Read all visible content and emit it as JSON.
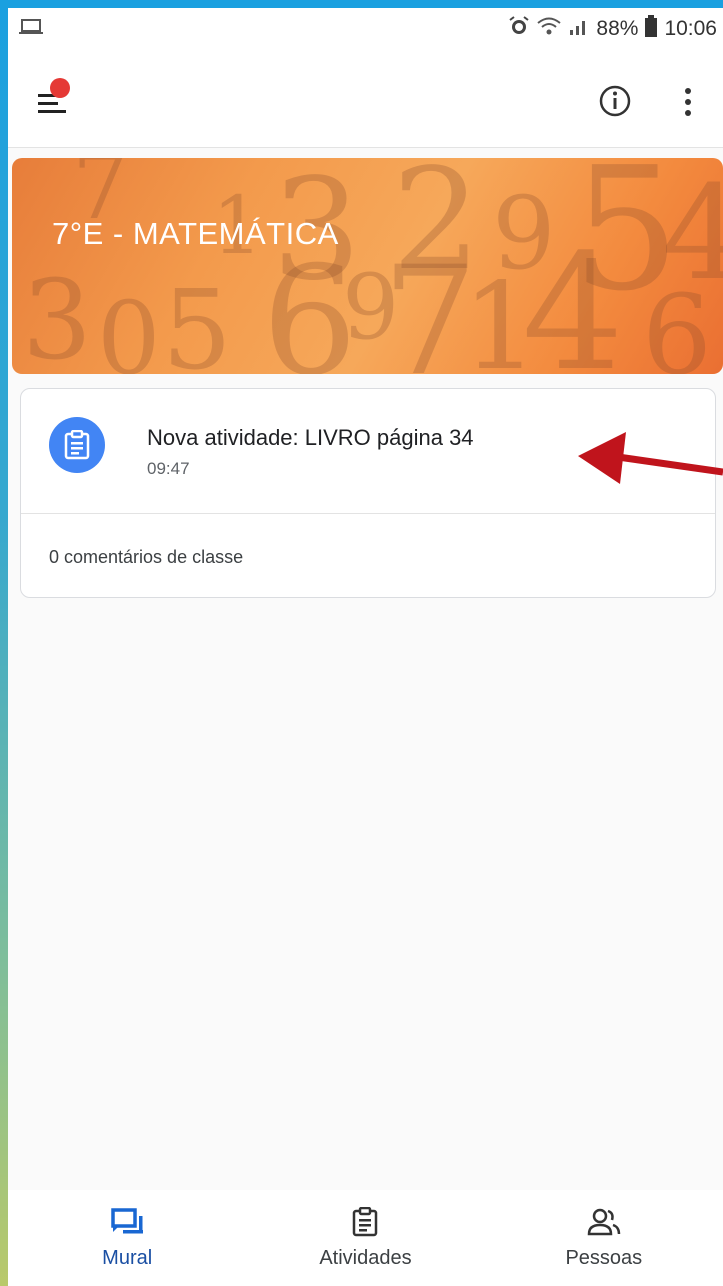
{
  "status_bar": {
    "battery": "88%",
    "time": "10:06",
    "icons": [
      "laptop-icon",
      "alarm-icon",
      "wifi-icon",
      "signal-icon",
      "battery-icon"
    ]
  },
  "app_bar": {
    "icons": [
      "menu-icon",
      "info-icon",
      "more-vert-icon"
    ],
    "notification_dot_color": "#e53935"
  },
  "class_banner": {
    "title": "7°E - MATEMÁTICA"
  },
  "stream": {
    "posts": [
      {
        "title": "Nova atividade: LIVRO página 34",
        "time": "09:47",
        "comments": "0 comentários de classe",
        "icon": "assignment-icon"
      }
    ]
  },
  "bottom_nav": {
    "items": [
      {
        "label": "Mural",
        "icon": "stream-icon",
        "active": true
      },
      {
        "label": "Atividades",
        "icon": "assignment-icon",
        "active": false
      },
      {
        "label": "Pessoas",
        "icon": "people-icon",
        "active": false
      }
    ]
  },
  "colors": {
    "accent": "#1967d2",
    "banner": "#f39a4c",
    "assignment_icon_bg": "#4285f4",
    "annotation_arrow": "#c0141c"
  }
}
